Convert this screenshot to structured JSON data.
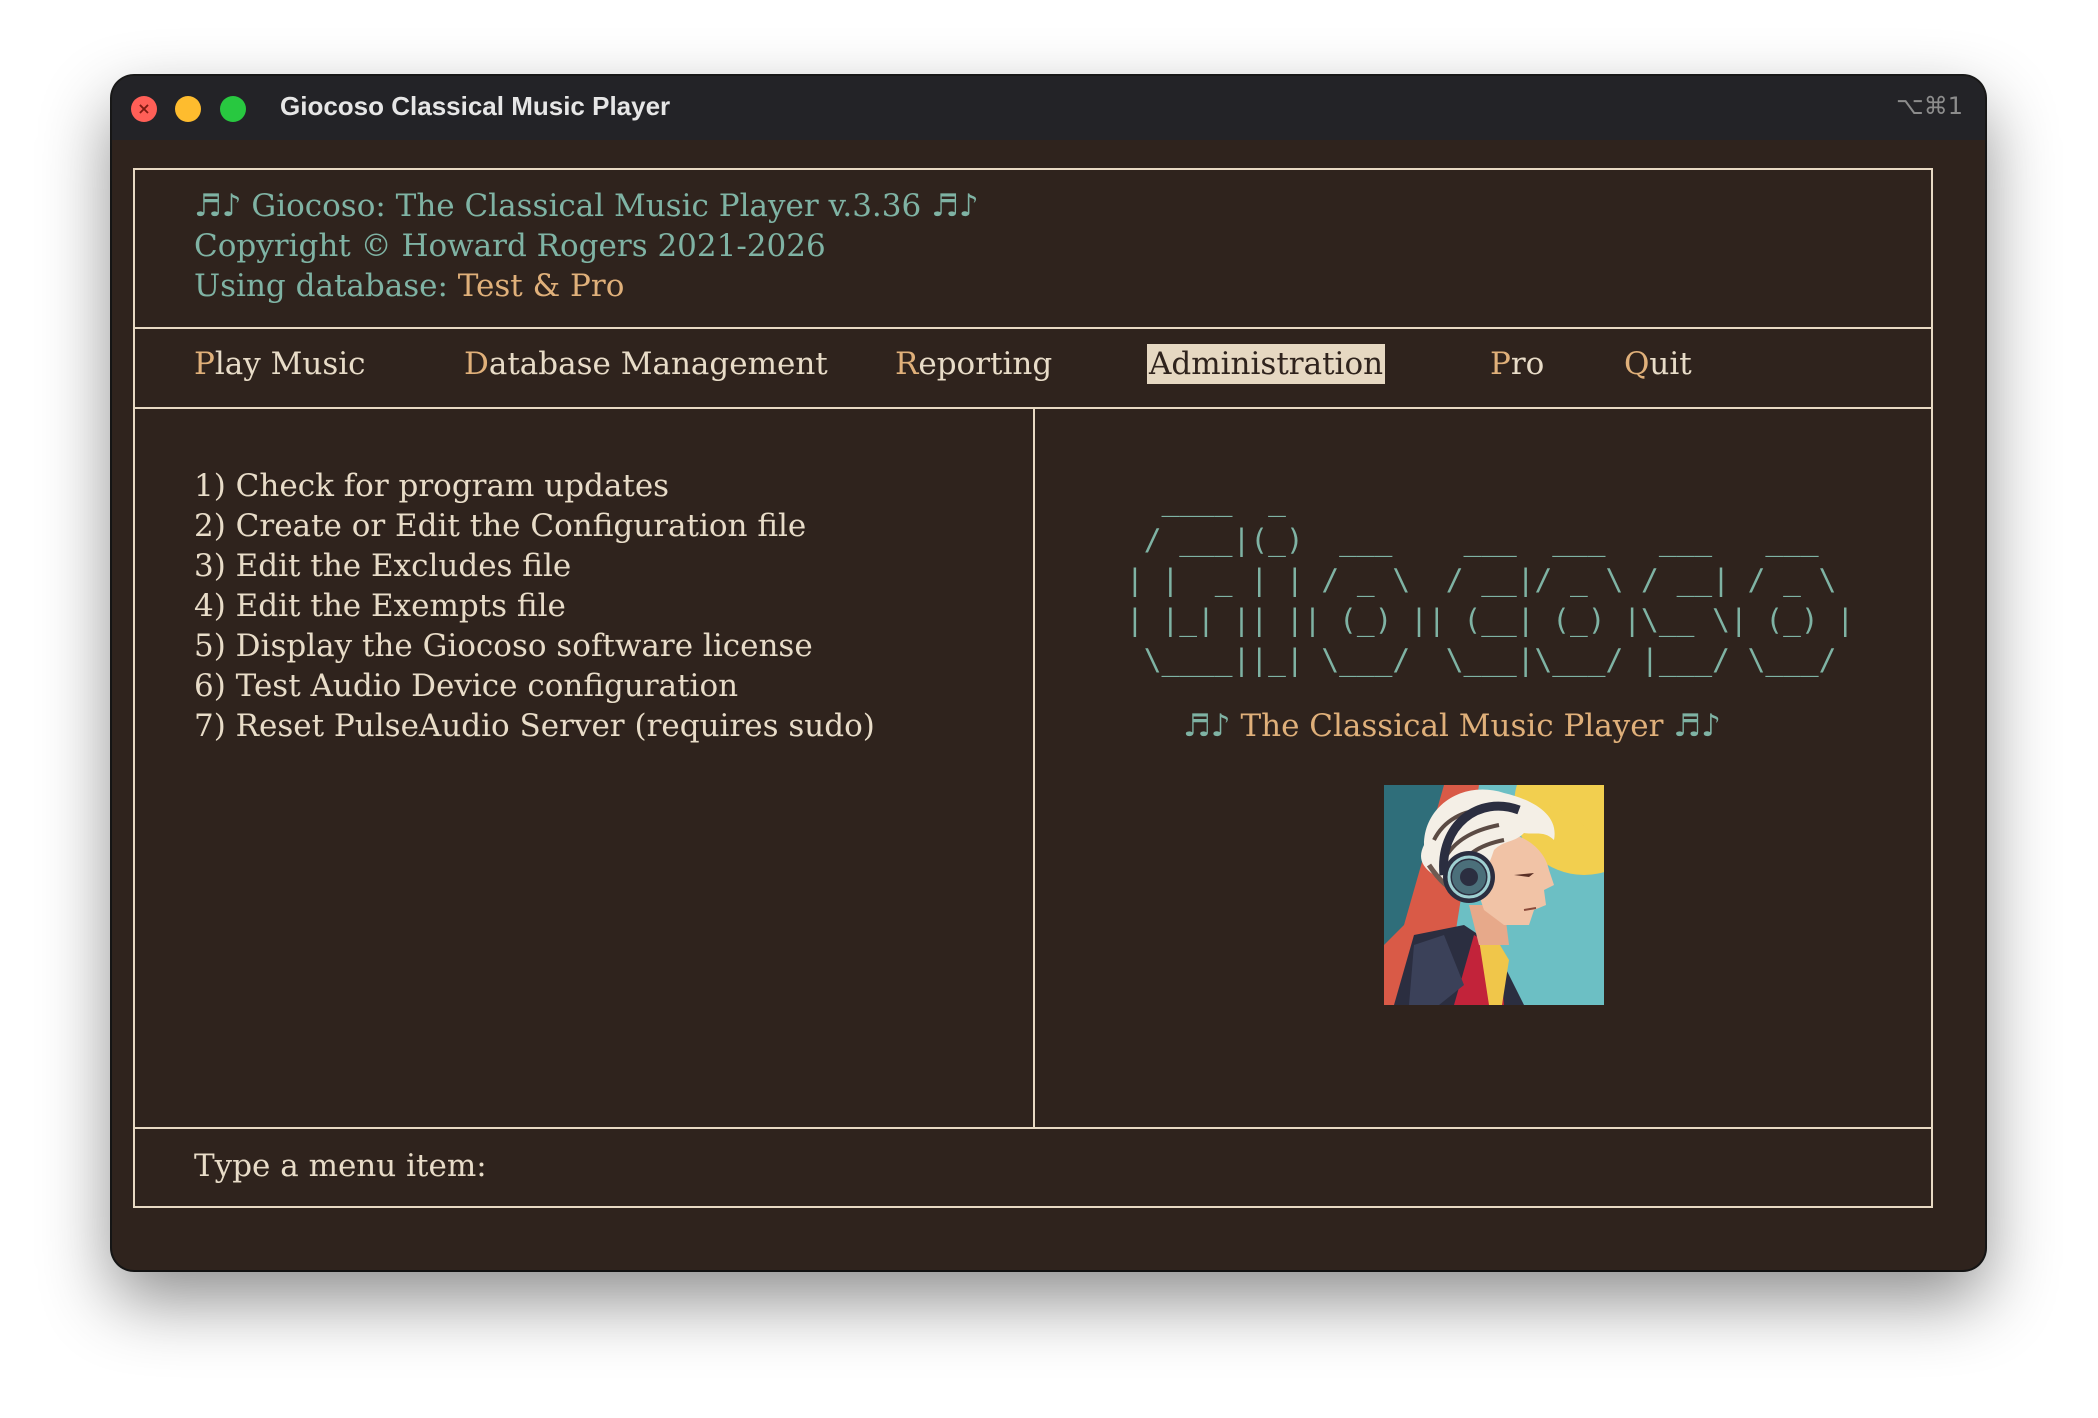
{
  "window": {
    "title": "Giocoso Classical Music Player",
    "shortcut": "⌥⌘1"
  },
  "header": {
    "line1": "♬♪ Giocoso: The Classical Music Player v.3.36 ♬♪",
    "line2": "Copyright © Howard Rogers 2021-2026",
    "db_label": "Using database: ",
    "db_name": "Test & Pro"
  },
  "menu": [
    {
      "hot": "P",
      "rest": "lay Music"
    },
    {
      "hot": "D",
      "rest": "atabase Management"
    },
    {
      "hot": "R",
      "rest": "eporting"
    },
    {
      "hot": "A",
      "rest": "dministration",
      "selected": true
    },
    {
      "hot": "P",
      "rest": "ro"
    },
    {
      "hot": "Q",
      "rest": "uit"
    }
  ],
  "options": [
    "1) Check for program updates",
    "2) Create or Edit the Configuration file",
    "3) Edit the Excludes file",
    "4) Edit the Exempts file",
    "5) Display the Giocoso software license",
    "6) Test Audio Device configuration",
    "7) Reset PulseAudio Server (requires sudo)"
  ],
  "logo": {
    "ascii": "  ____  _\n / ___|(_)  ___    ___  ___   ___   ___\n| |  _ | | / _ \\  / __|/ _ \\ / __| / _ \\\n| |_| || || (_) || (__| (_) |\\__ \\| (_) |\n \\____||_| \\___/  \\___|\\___/ |___/ \\___/",
    "tagline_icon": "♬♪",
    "tagline": "The Classical Music Player"
  },
  "prompt": "Type a menu item:",
  "icons": {
    "close": "close-icon",
    "minimize": "minimize-icon",
    "zoom": "zoom-icon",
    "portrait": "beethoven-headphones-icon"
  },
  "colors": {
    "background": "#2f231d",
    "border": "#e8d9c3",
    "teal": "#7fb3a4",
    "accent": "#e0b07a",
    "text": "#e8dcc8",
    "close": "#ff5f57",
    "minimize": "#febc2e",
    "zoom": "#28c840"
  }
}
